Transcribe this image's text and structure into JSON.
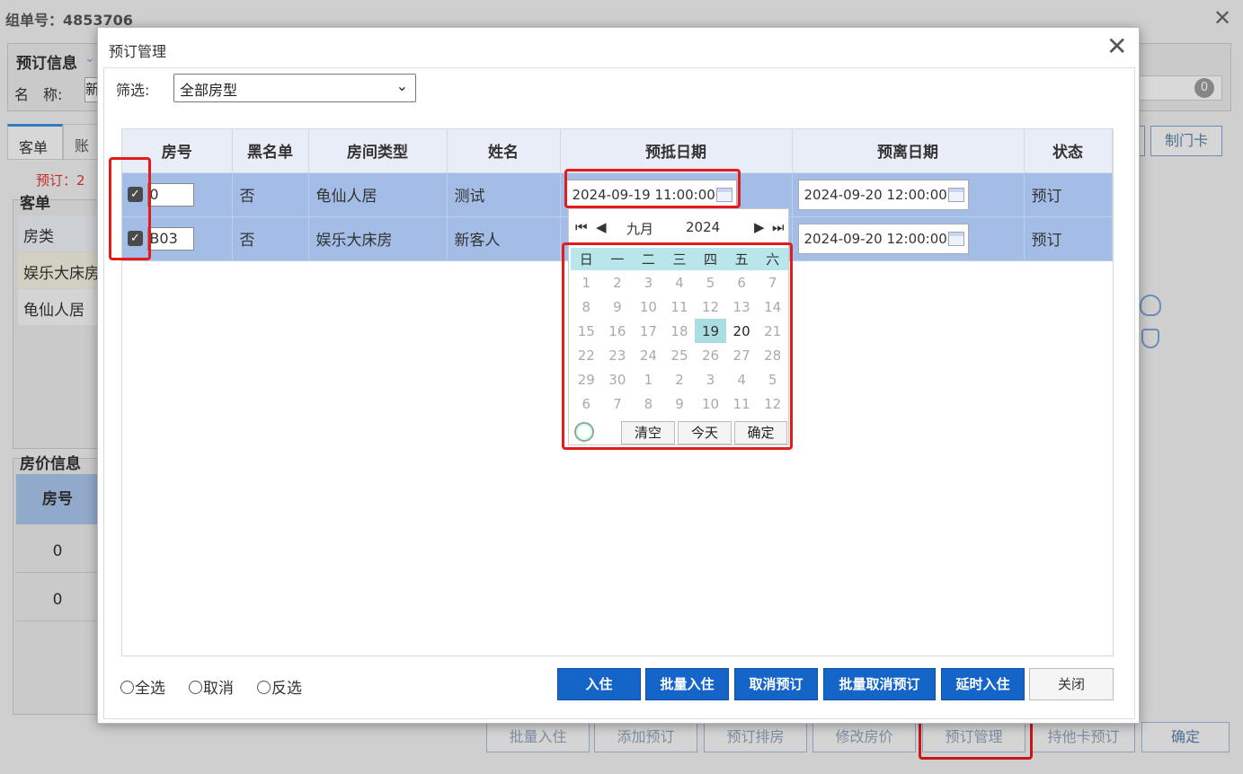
{
  "background": {
    "group_label": "组单号：4853706",
    "booking_info_label": "预订信息",
    "name_label": "名　称:",
    "name_value": "新",
    "badge": "0",
    "tabs": [
      "客单",
      "账单"
    ],
    "booked_text": "预订：2",
    "make_card_label": "制门卡",
    "guest_list_label": "客单",
    "room_type_header": "房类",
    "room_types": [
      "娱乐大床房",
      "龟仙人居"
    ],
    "price_info_label": "房价信息",
    "price_room_header": "房号",
    "price_rows": [
      "0",
      "0"
    ],
    "bottom_buttons": [
      "批量入住",
      "添加预订",
      "预订排房",
      "修改房价",
      "预订管理",
      "持他卡预订",
      "确定"
    ]
  },
  "modal": {
    "title": "预订管理",
    "filter_label": "筛选:",
    "filter_value": "全部房型",
    "columns": [
      "房号",
      "黑名单",
      "房间类型",
      "姓名",
      "预抵日期",
      "预离日期",
      "状态"
    ],
    "rows": [
      {
        "room": "0",
        "blacklist": "否",
        "room_type": "龟仙人居",
        "name": "测试",
        "arrival": "2024-09-19 11:00:00",
        "departure": "2024-09-20 12:00:00",
        "status": "预订"
      },
      {
        "room": "B03",
        "blacklist": "否",
        "room_type": "娱乐大床房",
        "name": "新客人",
        "arrival": "",
        "departure": "2024-09-20 12:00:00",
        "status": "预订"
      }
    ],
    "radios": [
      "全选",
      "取消",
      "反选"
    ],
    "actions": [
      "入住",
      "批量入住",
      "取消预订",
      "批量取消预订",
      "延时入住",
      "关闭"
    ]
  },
  "picker": {
    "month": "九月",
    "year": "2024",
    "weekdays": [
      "日",
      "一",
      "二",
      "三",
      "四",
      "五",
      "六"
    ],
    "weeks": [
      [
        "1",
        "2",
        "3",
        "4",
        "5",
        "6",
        "7"
      ],
      [
        "8",
        "9",
        "10",
        "11",
        "12",
        "13",
        "14"
      ],
      [
        "15",
        "16",
        "17",
        "18",
        "19",
        "20",
        "21"
      ],
      [
        "22",
        "23",
        "24",
        "25",
        "26",
        "27",
        "28"
      ],
      [
        "29",
        "30",
        "1",
        "2",
        "3",
        "4",
        "5"
      ],
      [
        "6",
        "7",
        "8",
        "9",
        "10",
        "11",
        "12"
      ]
    ],
    "selected_day": "19",
    "clear_label": "清空",
    "today_label": "今天",
    "ok_label": "确定"
  }
}
